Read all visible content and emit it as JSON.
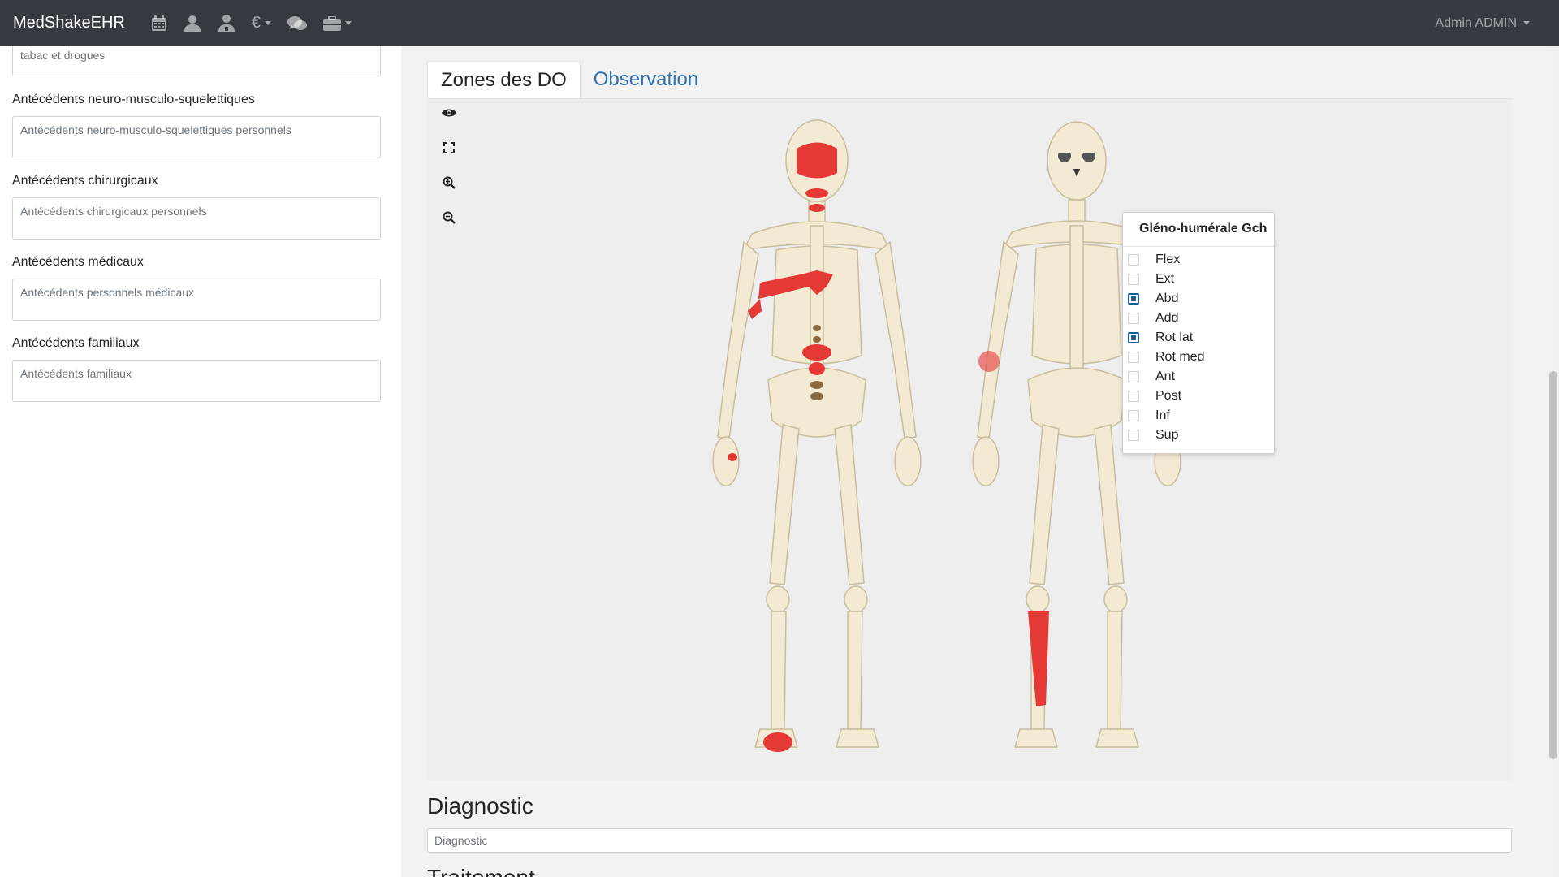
{
  "app": {
    "brand": "MedShakeEHR",
    "user": "Admin ADMIN"
  },
  "nav_icons": [
    "calendar-icon",
    "user-icon",
    "doctor-icon",
    "euro-icon",
    "chat-icon",
    "toolbox-icon"
  ],
  "left_form": {
    "partial_textarea_value": "tabac et drogues",
    "fields": [
      {
        "label": "Antécédents neuro-musculo-squelettiques",
        "placeholder": "Antécédents neuro-musculo-squelettiques personnels"
      },
      {
        "label": "Antécédents chirurgicaux",
        "placeholder": "Antécédents chirurgicaux personnels"
      },
      {
        "label": "Antécédents médicaux",
        "placeholder": "Antécédents personnels médicaux"
      },
      {
        "label": "Antécédents familiaux",
        "placeholder": "Antécédents familiaux"
      }
    ]
  },
  "tabs": [
    {
      "label": "Zones des DO",
      "active": true
    },
    {
      "label": "Observation",
      "active": false
    }
  ],
  "tools": [
    "eye-icon",
    "fullscreen-icon",
    "zoom-in-icon",
    "zoom-out-icon"
  ],
  "popup": {
    "title": "Gléno-humérale Gch",
    "options": [
      {
        "label": "Flex",
        "checked": false
      },
      {
        "label": "Ext",
        "checked": false
      },
      {
        "label": "Abd",
        "checked": true
      },
      {
        "label": "Add",
        "checked": false
      },
      {
        "label": "Rot lat",
        "checked": true
      },
      {
        "label": "Rot med",
        "checked": false
      },
      {
        "label": "Ant",
        "checked": false
      },
      {
        "label": "Post",
        "checked": false
      },
      {
        "label": "Inf",
        "checked": false
      },
      {
        "label": "Sup",
        "checked": false
      }
    ]
  },
  "diagnostic": {
    "title": "Diagnostic",
    "placeholder": "Diagnostic"
  },
  "next_section_title": "Traitement",
  "colors": {
    "navbar": "#343a40",
    "highlight": "#e53935",
    "bone": "#f3ead3",
    "link": "#2a73b6"
  }
}
